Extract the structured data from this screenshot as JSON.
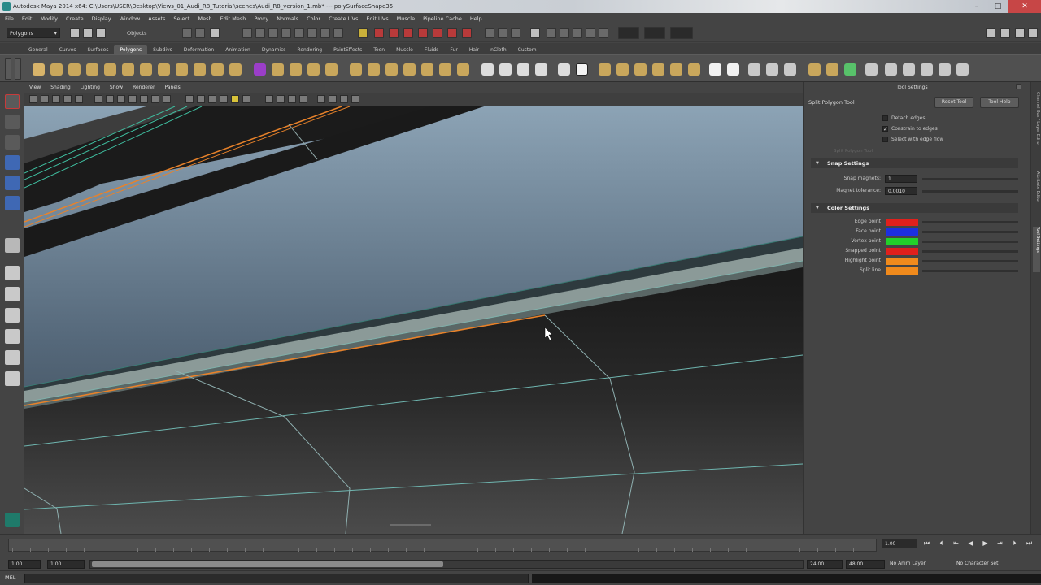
{
  "window": {
    "title": "Autodesk Maya 2014 x64: C:\\Users\\USER\\Desktop\\Views_01_Audi_R8_Tutorial\\scenes\\Audi_R8_version_1.mb*  ---  polySurfaceShape35"
  },
  "menubar": [
    "File",
    "Edit",
    "Modify",
    "Create",
    "Display",
    "Window",
    "Assets",
    "Select",
    "Mesh",
    "Edit Mesh",
    "Proxy",
    "Normals",
    "Color",
    "Create UVs",
    "Edit UVs",
    "Muscle",
    "Pipeline Cache",
    "Help"
  ],
  "statusline": {
    "menuset": "Polygons",
    "selection_mode": "Objects"
  },
  "shelf_tabs": {
    "items": [
      "General",
      "Curves",
      "Surfaces",
      "Polygons",
      "Subdivs",
      "Deformation",
      "Animation",
      "Dynamics",
      "Rendering",
      "PaintEffects",
      "Toon",
      "Muscle",
      "Fluids",
      "Fur",
      "Hair",
      "nCloth",
      "Custom"
    ],
    "active": "Polygons"
  },
  "panel_menu": [
    "View",
    "Shading",
    "Lighting",
    "Show",
    "Renderer",
    "Panels"
  ],
  "tool_settings": {
    "title": "Tool Settings",
    "tool_name": "Split Polygon Tool",
    "reset_label": "Reset Tool",
    "help_label": "Tool Help",
    "options": [
      {
        "label": "Detach edges",
        "checked": false
      },
      {
        "label": "Constrain to edges",
        "checked": true
      },
      {
        "label": "Select with edge flow",
        "checked": false
      }
    ],
    "faded_label": "Split Polygon Tool",
    "snap_section": "Snap Settings",
    "snap_magnets_label": "Snap magnets:",
    "snap_magnets_value": "1",
    "magnet_tolerance_label": "Magnet tolerance:",
    "magnet_tolerance_value": "0.0010",
    "color_section": "Color Settings",
    "colors": [
      {
        "label": "Edge point",
        "color": "#e0201c"
      },
      {
        "label": "Face point",
        "color": "#1c2fe0"
      },
      {
        "label": "Vertex point",
        "color": "#22d02a"
      },
      {
        "label": "Snapped point",
        "color": "#e0201c"
      },
      {
        "label": "Highlight point",
        "color": "#f08a1c"
      },
      {
        "label": "Split line",
        "color": "#f08a1c"
      }
    ],
    "side_tabs": [
      "Channel Box / Layer Editor",
      "Attribute Editor",
      "Tool Settings"
    ]
  },
  "timeline": {
    "current_frame": "1.00",
    "start": "1.00",
    "range_start": "1.00",
    "range_end": "24.00",
    "end": "48.00",
    "anim_layer": "No Anim Layer",
    "char_set": "No Character Set"
  },
  "command_line": {
    "label": "MEL"
  }
}
